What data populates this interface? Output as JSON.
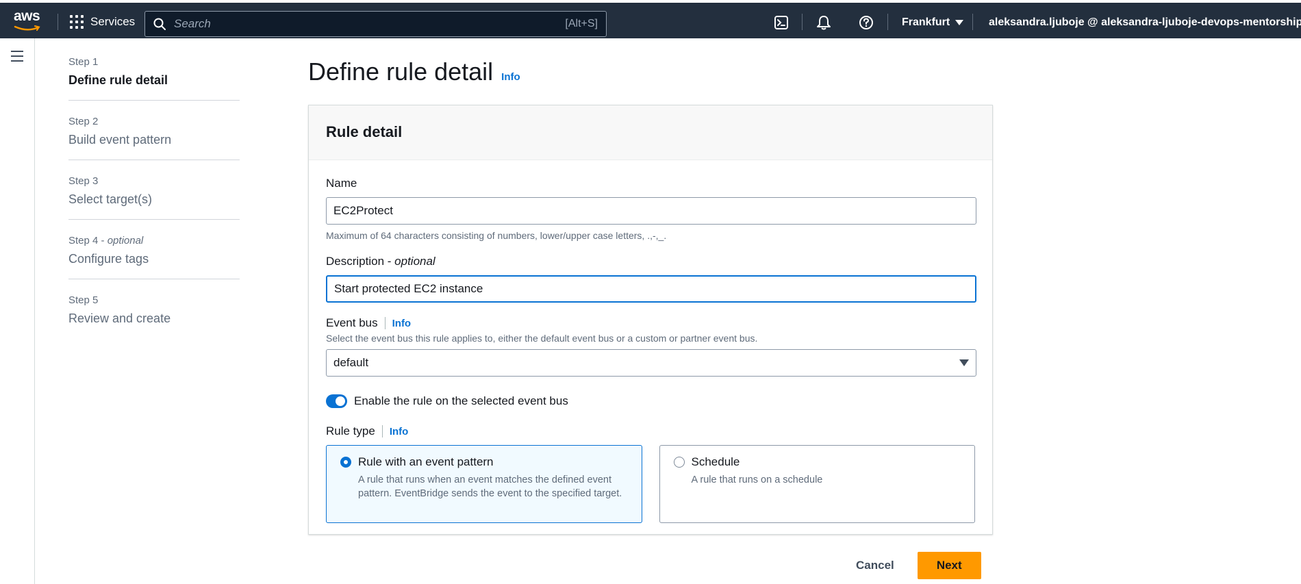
{
  "topnav": {
    "logo_text": "aws",
    "services_label": "Services",
    "search_placeholder": "Search",
    "search_shortcut": "[Alt+S]",
    "region": "Frankfurt",
    "account": "aleksandra.ljuboje @ aleksandra-ljuboje-devops-mentorship",
    "bg_color": "#232f3e"
  },
  "steps": [
    {
      "number": "Step 1",
      "title": "Define rule detail",
      "active": true
    },
    {
      "number": "Step 2",
      "title": "Build event pattern"
    },
    {
      "number": "Step 3",
      "title": "Select target(s)"
    },
    {
      "number": "Step 4",
      "number_suffix": "optional",
      "title": "Configure tags"
    },
    {
      "number": "Step 5",
      "title": "Review and create"
    }
  ],
  "page": {
    "title": "Define rule detail",
    "info": "Info"
  },
  "panel": {
    "header": "Rule detail",
    "name_label": "Name",
    "name_value": "EC2Protect",
    "name_hint": "Maximum of 64 characters consisting of numbers, lower/upper case letters, .,-,_.",
    "description_label": "Description",
    "description_optional": "optional",
    "description_value": "Start protected EC2 instance",
    "event_bus_label": "Event bus",
    "event_bus_info": "Info",
    "event_bus_hint": "Select the event bus this rule applies to, either the default event bus or a custom or partner event bus.",
    "event_bus_value": "default",
    "toggle_label": "Enable the rule on the selected event bus",
    "toggle_on": true,
    "rule_type_label": "Rule type",
    "rule_type_info": "Info",
    "options": [
      {
        "title": "Rule with an event pattern",
        "description": "A rule that runs when an event matches the defined event pattern. EventBridge sends the event to the specified target.",
        "selected": true
      },
      {
        "title": "Schedule",
        "description": "A rule that runs on a schedule",
        "selected": false
      }
    ]
  },
  "actions": {
    "cancel": "Cancel",
    "next": "Next"
  },
  "colors": {
    "accent": "#0972d3",
    "primary_button": "#ff9900"
  }
}
